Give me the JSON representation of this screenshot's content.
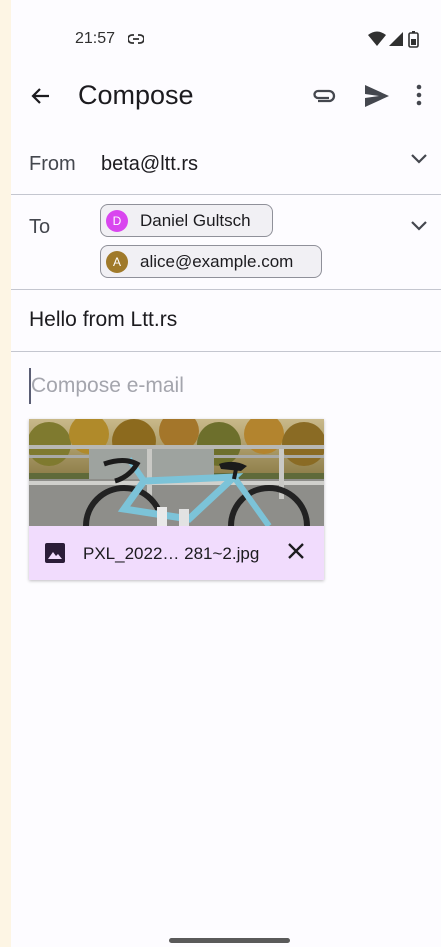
{
  "status_bar": {
    "time": "21:57"
  },
  "appbar": {
    "title": "Compose"
  },
  "from": {
    "label": "From",
    "value": "beta@ltt.rs"
  },
  "to": {
    "label": "To",
    "recipients": [
      {
        "initial": "D",
        "name": "Daniel Gultsch",
        "color": "#d946ef"
      },
      {
        "initial": "A",
        "name": "alice@example.com",
        "color": "#a07a2a"
      }
    ]
  },
  "subject": {
    "value": "Hello from Ltt.rs"
  },
  "body": {
    "placeholder": "Compose e-mail"
  },
  "attachment": {
    "filename": "PXL_2022… 281~2.jpg"
  },
  "colors": {
    "attachment_bar": "#f1dcfd",
    "background": "#fdfcff",
    "outer_background": "#fdf5e4"
  }
}
